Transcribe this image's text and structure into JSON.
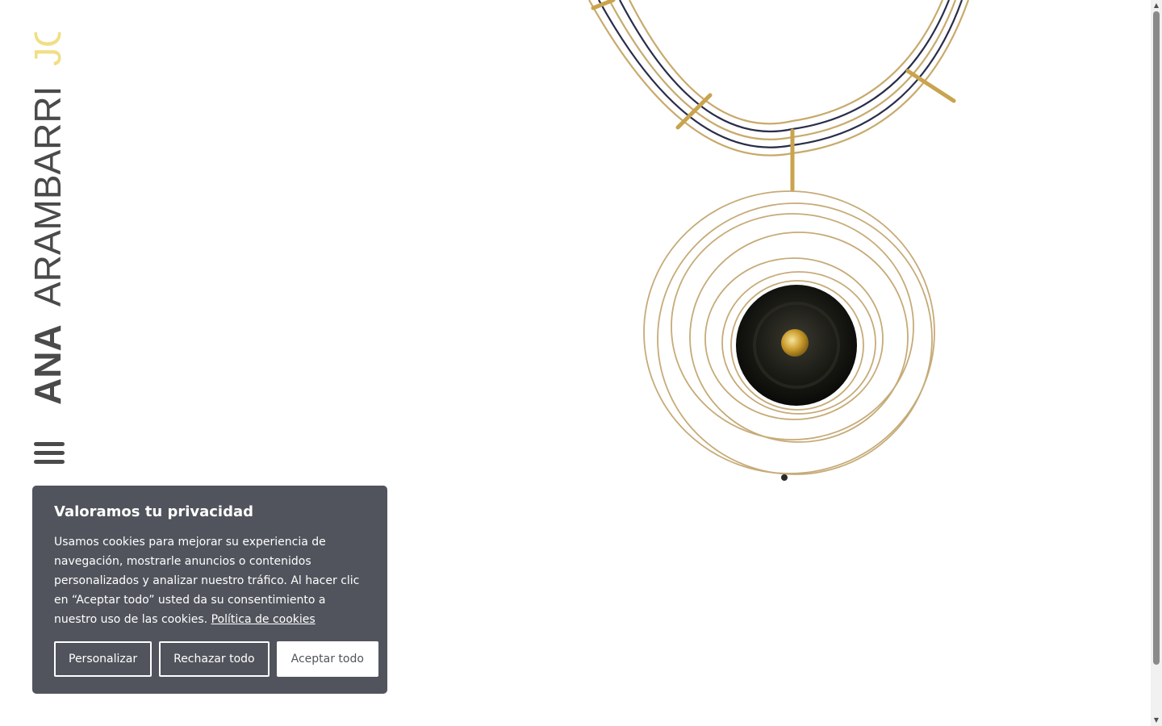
{
  "brand": {
    "first": "ANA",
    "last": "ARAMBARRI",
    "suffix": "JOYAS",
    "colors": {
      "dark": "#4a4a4a",
      "accent": "#f1de86"
    }
  },
  "menu": {
    "icon": "hamburger-icon"
  },
  "hero": {
    "subject": "necklace-image"
  },
  "cookie": {
    "title": "Valoramos tu privacidad",
    "text": "Usamos cookies para mejorar su experiencia de navegación, mostrarle anuncios o contenidos personalizados y analizar nuestro tráfico. Al hacer clic en “Aceptar todo” usted da su consentimiento a nuestro uso de las cookies.",
    "policy_link": "Política de cookies",
    "buttons": {
      "customize": "Personalizar",
      "reject": "Rechazar todo",
      "accept": "Aceptar todo"
    },
    "colors": {
      "background": "#51545c",
      "text": "#ffffff"
    }
  },
  "scrollbar": {
    "up": "▲",
    "down": "▼"
  }
}
